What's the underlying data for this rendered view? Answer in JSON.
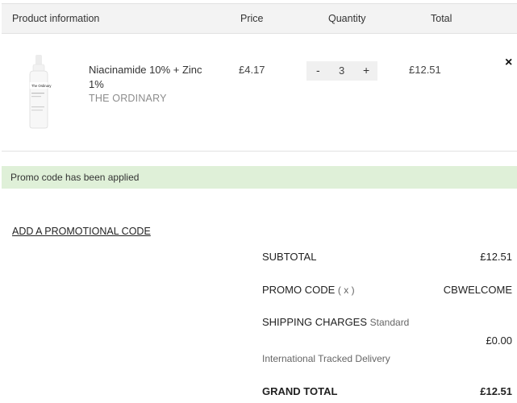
{
  "table_header": {
    "product": "Product information",
    "price": "Price",
    "quantity": "Quantity",
    "total": "Total"
  },
  "product": {
    "name": "Niacinamide 10% + Zinc 1%",
    "brand": "THE ORDINARY",
    "bottle_label": "The Ordinary",
    "price": "£4.17",
    "quantity": "3",
    "minus": "-",
    "plus": "+",
    "total": "£12.51",
    "remove": "×"
  },
  "promo_banner": "Promo code has been applied",
  "add_promo_link": "ADD A PROMOTIONAL CODE",
  "summary": {
    "subtotal_label": "SUBTOTAL",
    "subtotal_value": "£12.51",
    "promo_label": "PROMO CODE",
    "promo_remove": "( x )",
    "promo_value": "CBWELCOME",
    "shipping_label": "SHIPPING CHARGES",
    "shipping_type": "Standard",
    "shipping_value": "£0.00",
    "shipping_method": "International Tracked Delivery",
    "grand_total_label": "GRAND TOTAL",
    "grand_total_value": "£12.51"
  }
}
